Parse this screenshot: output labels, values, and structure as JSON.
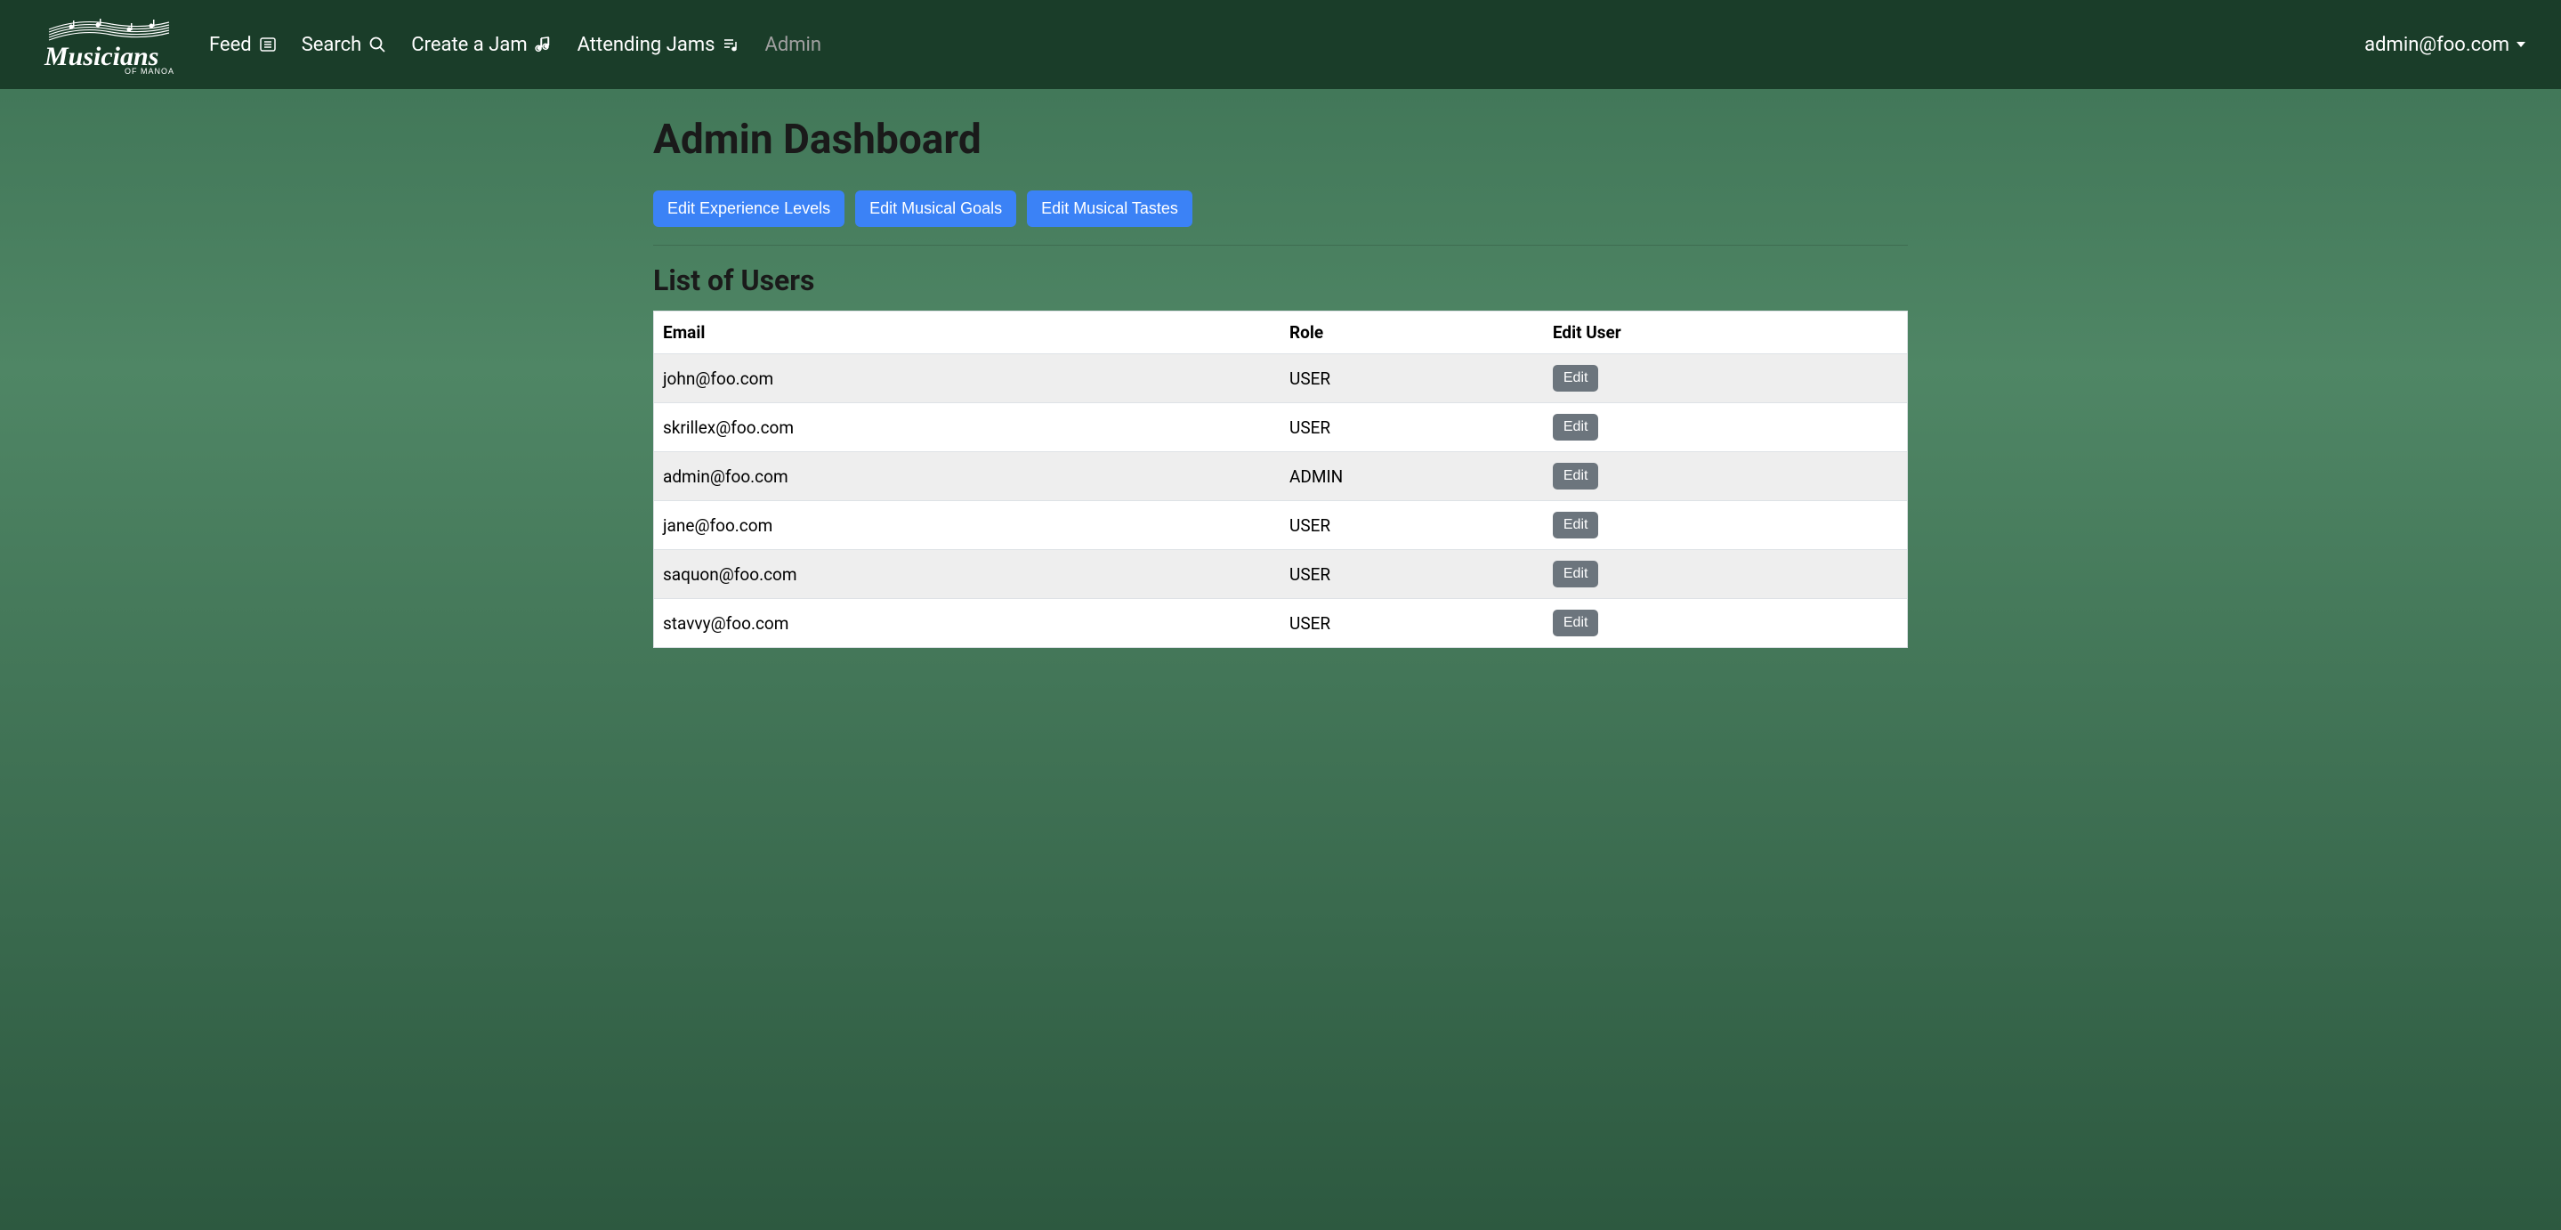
{
  "brand": {
    "name": "Musicians",
    "subtitle": "OF MANOA"
  },
  "nav": {
    "items": [
      {
        "label": "Feed",
        "icon": "feed"
      },
      {
        "label": "Search",
        "icon": "search"
      },
      {
        "label": "Create a Jam",
        "icon": "music-note"
      },
      {
        "label": "Attending Jams",
        "icon": "music-list"
      },
      {
        "label": "Admin",
        "icon": null,
        "active": true
      }
    ],
    "user_email": "admin@foo.com"
  },
  "page": {
    "title": "Admin Dashboard",
    "buttons": [
      {
        "label": "Edit Experience Levels"
      },
      {
        "label": "Edit Musical Goals"
      },
      {
        "label": "Edit Musical Tastes"
      }
    ],
    "users_section": {
      "title": "List of Users",
      "columns": [
        "Email",
        "Role",
        "Edit User"
      ],
      "rows": [
        {
          "email": "john@foo.com",
          "role": "USER",
          "edit_label": "Edit"
        },
        {
          "email": "skrillex@foo.com",
          "role": "USER",
          "edit_label": "Edit"
        },
        {
          "email": "admin@foo.com",
          "role": "ADMIN",
          "edit_label": "Edit"
        },
        {
          "email": "jane@foo.com",
          "role": "USER",
          "edit_label": "Edit"
        },
        {
          "email": "saquon@foo.com",
          "role": "USER",
          "edit_label": "Edit"
        },
        {
          "email": "stavvy@foo.com",
          "role": "USER",
          "edit_label": "Edit"
        }
      ]
    }
  }
}
